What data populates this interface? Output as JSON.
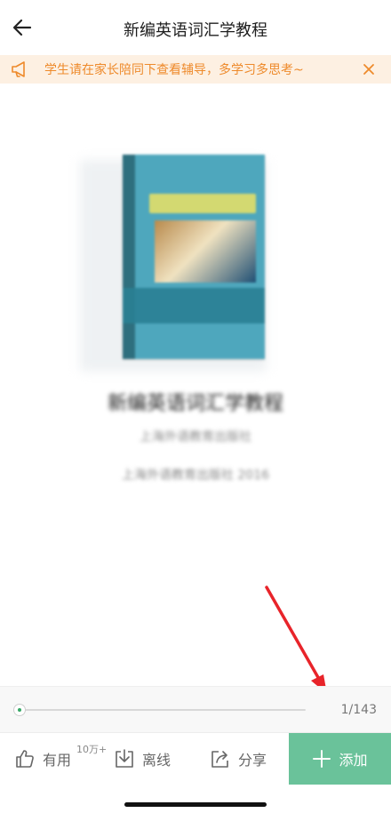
{
  "header": {
    "title": "新编英语词汇学教程",
    "back_icon": "arrow-left-icon"
  },
  "notice": {
    "text": "学生请在家长陪同下查看辅导，多学习多思考~",
    "icon": "megaphone-icon",
    "close_icon": "close-icon",
    "color": "#ee8a2b",
    "background": "#fdf0e2"
  },
  "book": {
    "title": "新编英语词汇学教程",
    "meta_line_1": "上海外语教育出版社",
    "meta_line_2": "上海外语教育出版社 2016"
  },
  "reader": {
    "progress_fraction": 0.0,
    "page_current": "1",
    "page_total": "143",
    "page_label": "1/143"
  },
  "toolbar": {
    "useful_label": "有用",
    "useful_count": "10万+",
    "offline_label": "离线",
    "share_label": "分享",
    "add_label": "添加",
    "accent_color": "#6ac29a",
    "progress_color": "#36a865"
  }
}
